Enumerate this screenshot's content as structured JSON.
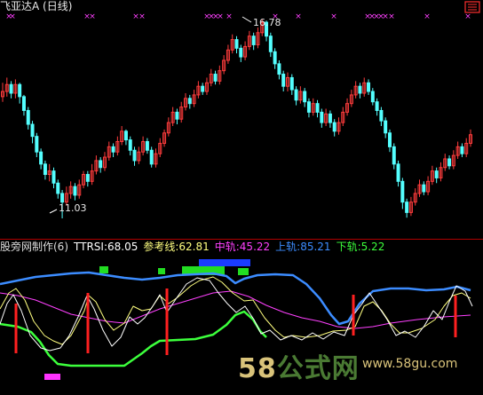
{
  "main_panel": {
    "title": "飞亚达A (日线)",
    "high_label": "16.78",
    "low_label": "11.03"
  },
  "indicator_panel": {
    "name": "股旁网制作(6)",
    "ttrsi_label": "TTRSI:68.05",
    "ref_label": "参考线:62.81",
    "mid_label": "中轨:45.22",
    "upper_label": "上轨:85.21",
    "lower_label": "下轨:5.22"
  },
  "watermark": {
    "brand_58": "58",
    "brand_cn": "公式网",
    "url": "www.58gu.com"
  },
  "colors": {
    "up": "#ff3c3c",
    "down": "#54ffff",
    "ttrsi": "#ffffff",
    "ref": "#ffff80",
    "mid": "#ff40ff",
    "upper": "#3c8cff",
    "lower": "#3cff3c",
    "signal": "#ff2020",
    "divider": "#b00000"
  },
  "chart_data": {
    "type": "candlestick",
    "price_high": 16.78,
    "price_low": 11.03,
    "candles": [
      [
        14.55,
        14.7,
        14.95,
        14.4
      ],
      [
        14.7,
        14.9,
        15.1,
        14.55
      ],
      [
        14.9,
        14.65,
        15.0,
        14.5
      ],
      [
        14.65,
        14.9,
        15.05,
        14.5
      ],
      [
        14.9,
        14.55,
        14.95,
        14.35
      ],
      [
        14.55,
        14.15,
        14.6,
        14.0
      ],
      [
        14.15,
        13.75,
        14.25,
        13.6
      ],
      [
        13.75,
        13.4,
        13.85,
        13.2
      ],
      [
        13.4,
        12.95,
        13.5,
        12.8
      ],
      [
        12.95,
        12.6,
        13.05,
        12.45
      ],
      [
        12.6,
        12.3,
        12.7,
        12.15
      ],
      [
        12.3,
        12.4,
        12.6,
        12.1
      ],
      [
        12.4,
        12.05,
        12.5,
        11.9
      ],
      [
        12.05,
        11.75,
        12.15,
        11.6
      ],
      [
        11.75,
        11.5,
        11.85,
        11.03
      ],
      [
        11.5,
        11.75,
        11.95,
        11.4
      ],
      [
        11.75,
        11.95,
        12.1,
        11.6
      ],
      [
        11.95,
        11.7,
        12.05,
        11.55
      ],
      [
        11.7,
        12.0,
        12.15,
        11.6
      ],
      [
        12.0,
        12.3,
        12.4,
        11.9
      ],
      [
        12.3,
        12.1,
        12.4,
        11.95
      ],
      [
        12.1,
        12.4,
        12.6,
        12.0
      ],
      [
        12.4,
        12.7,
        12.85,
        12.3
      ],
      [
        12.7,
        12.5,
        12.8,
        12.35
      ],
      [
        12.5,
        12.8,
        12.95,
        12.4
      ],
      [
        12.8,
        13.1,
        13.25,
        12.7
      ],
      [
        13.1,
        12.95,
        13.2,
        12.8
      ],
      [
        12.95,
        13.25,
        13.4,
        12.85
      ],
      [
        13.25,
        13.55,
        13.7,
        13.15
      ],
      [
        13.55,
        13.3,
        13.6,
        13.15
      ],
      [
        13.3,
        13.0,
        13.4,
        12.85
      ],
      [
        13.0,
        12.7,
        13.1,
        12.55
      ],
      [
        12.7,
        12.95,
        13.1,
        12.6
      ],
      [
        12.95,
        13.25,
        13.4,
        12.85
      ],
      [
        13.25,
        13.0,
        13.35,
        12.9
      ],
      [
        13.0,
        12.6,
        13.1,
        12.5
      ],
      [
        12.6,
        12.9,
        13.05,
        12.5
      ],
      [
        12.9,
        13.2,
        13.35,
        12.8
      ],
      [
        13.2,
        13.5,
        13.6,
        13.1
      ],
      [
        13.5,
        13.8,
        13.95,
        13.4
      ],
      [
        13.8,
        14.1,
        14.25,
        13.7
      ],
      [
        14.1,
        13.9,
        14.2,
        13.75
      ],
      [
        13.9,
        14.25,
        14.4,
        13.8
      ],
      [
        14.25,
        14.5,
        14.65,
        14.15
      ],
      [
        14.5,
        14.35,
        14.6,
        14.2
      ],
      [
        14.35,
        14.6,
        14.75,
        14.25
      ],
      [
        14.6,
        14.85,
        15.0,
        14.5
      ],
      [
        14.85,
        14.7,
        14.95,
        14.6
      ],
      [
        14.7,
        14.95,
        15.1,
        14.6
      ],
      [
        14.95,
        15.2,
        15.35,
        14.85
      ],
      [
        15.2,
        15.0,
        15.3,
        14.9
      ],
      [
        15.0,
        15.3,
        15.45,
        14.9
      ],
      [
        15.3,
        15.6,
        15.75,
        15.2
      ],
      [
        15.6,
        15.9,
        16.05,
        15.5
      ],
      [
        15.9,
        16.2,
        16.35,
        15.8
      ],
      [
        16.2,
        15.95,
        16.3,
        15.8
      ],
      [
        15.95,
        15.7,
        16.05,
        15.55
      ],
      [
        15.7,
        16.0,
        16.15,
        15.6
      ],
      [
        16.0,
        16.3,
        16.45,
        15.9
      ],
      [
        16.3,
        16.05,
        16.4,
        15.9
      ],
      [
        16.05,
        16.4,
        16.55,
        15.95
      ],
      [
        16.4,
        16.7,
        16.78,
        16.3
      ],
      [
        16.7,
        16.3,
        16.75,
        16.15
      ],
      [
        16.3,
        15.85,
        16.4,
        15.7
      ],
      [
        15.85,
        15.5,
        15.95,
        15.35
      ],
      [
        15.5,
        15.2,
        15.6,
        15.05
      ],
      [
        15.2,
        14.85,
        15.3,
        14.7
      ],
      [
        14.85,
        15.1,
        15.25,
        14.7
      ],
      [
        15.1,
        14.75,
        15.2,
        14.6
      ],
      [
        14.75,
        14.45,
        14.85,
        14.3
      ],
      [
        14.45,
        14.7,
        14.85,
        14.35
      ],
      [
        14.7,
        14.4,
        14.8,
        14.25
      ],
      [
        14.4,
        14.1,
        14.5,
        13.95
      ],
      [
        14.1,
        14.35,
        14.5,
        14.0
      ],
      [
        14.35,
        14.1,
        14.45,
        13.95
      ],
      [
        14.1,
        13.8,
        14.2,
        13.65
      ],
      [
        13.8,
        14.05,
        14.2,
        13.7
      ],
      [
        14.05,
        13.8,
        14.15,
        13.65
      ],
      [
        13.8,
        13.55,
        13.9,
        13.4
      ],
      [
        13.55,
        13.8,
        13.95,
        13.45
      ],
      [
        13.8,
        14.1,
        14.25,
        13.7
      ],
      [
        14.1,
        14.35,
        14.5,
        14.0
      ],
      [
        14.35,
        14.6,
        14.75,
        14.25
      ],
      [
        14.6,
        14.85,
        15.0,
        14.5
      ],
      [
        14.85,
        14.65,
        14.95,
        14.5
      ],
      [
        14.65,
        14.95,
        15.1,
        14.55
      ],
      [
        14.95,
        14.7,
        15.05,
        14.6
      ],
      [
        14.7,
        14.4,
        14.8,
        14.3
      ],
      [
        14.4,
        14.15,
        14.5,
        14.0
      ],
      [
        14.15,
        13.85,
        14.25,
        13.7
      ],
      [
        13.85,
        13.5,
        13.95,
        13.35
      ],
      [
        13.5,
        13.1,
        13.6,
        12.95
      ],
      [
        13.1,
        12.6,
        13.2,
        12.45
      ],
      [
        12.6,
        12.1,
        12.7,
        11.95
      ],
      [
        12.1,
        11.5,
        12.2,
        11.3
      ],
      [
        11.5,
        11.2,
        11.6,
        11.05
      ],
      [
        11.2,
        11.5,
        11.65,
        11.1
      ],
      [
        11.5,
        11.75,
        11.9,
        11.4
      ],
      [
        11.75,
        12.0,
        12.15,
        11.65
      ],
      [
        12.0,
        11.8,
        12.1,
        11.7
      ],
      [
        11.8,
        12.1,
        12.25,
        11.7
      ],
      [
        12.1,
        12.4,
        12.55,
        12.0
      ],
      [
        12.4,
        12.2,
        12.5,
        12.05
      ],
      [
        12.2,
        12.5,
        12.65,
        12.1
      ],
      [
        12.5,
        12.75,
        12.9,
        12.4
      ],
      [
        12.75,
        12.55,
        12.85,
        12.45
      ],
      [
        12.55,
        12.85,
        13.0,
        12.45
      ],
      [
        12.85,
        13.1,
        13.25,
        12.75
      ],
      [
        13.1,
        12.9,
        13.2,
        12.8
      ],
      [
        12.9,
        13.2,
        13.35,
        12.8
      ],
      [
        13.2,
        13.45,
        13.6,
        13.1
      ]
    ]
  }
}
